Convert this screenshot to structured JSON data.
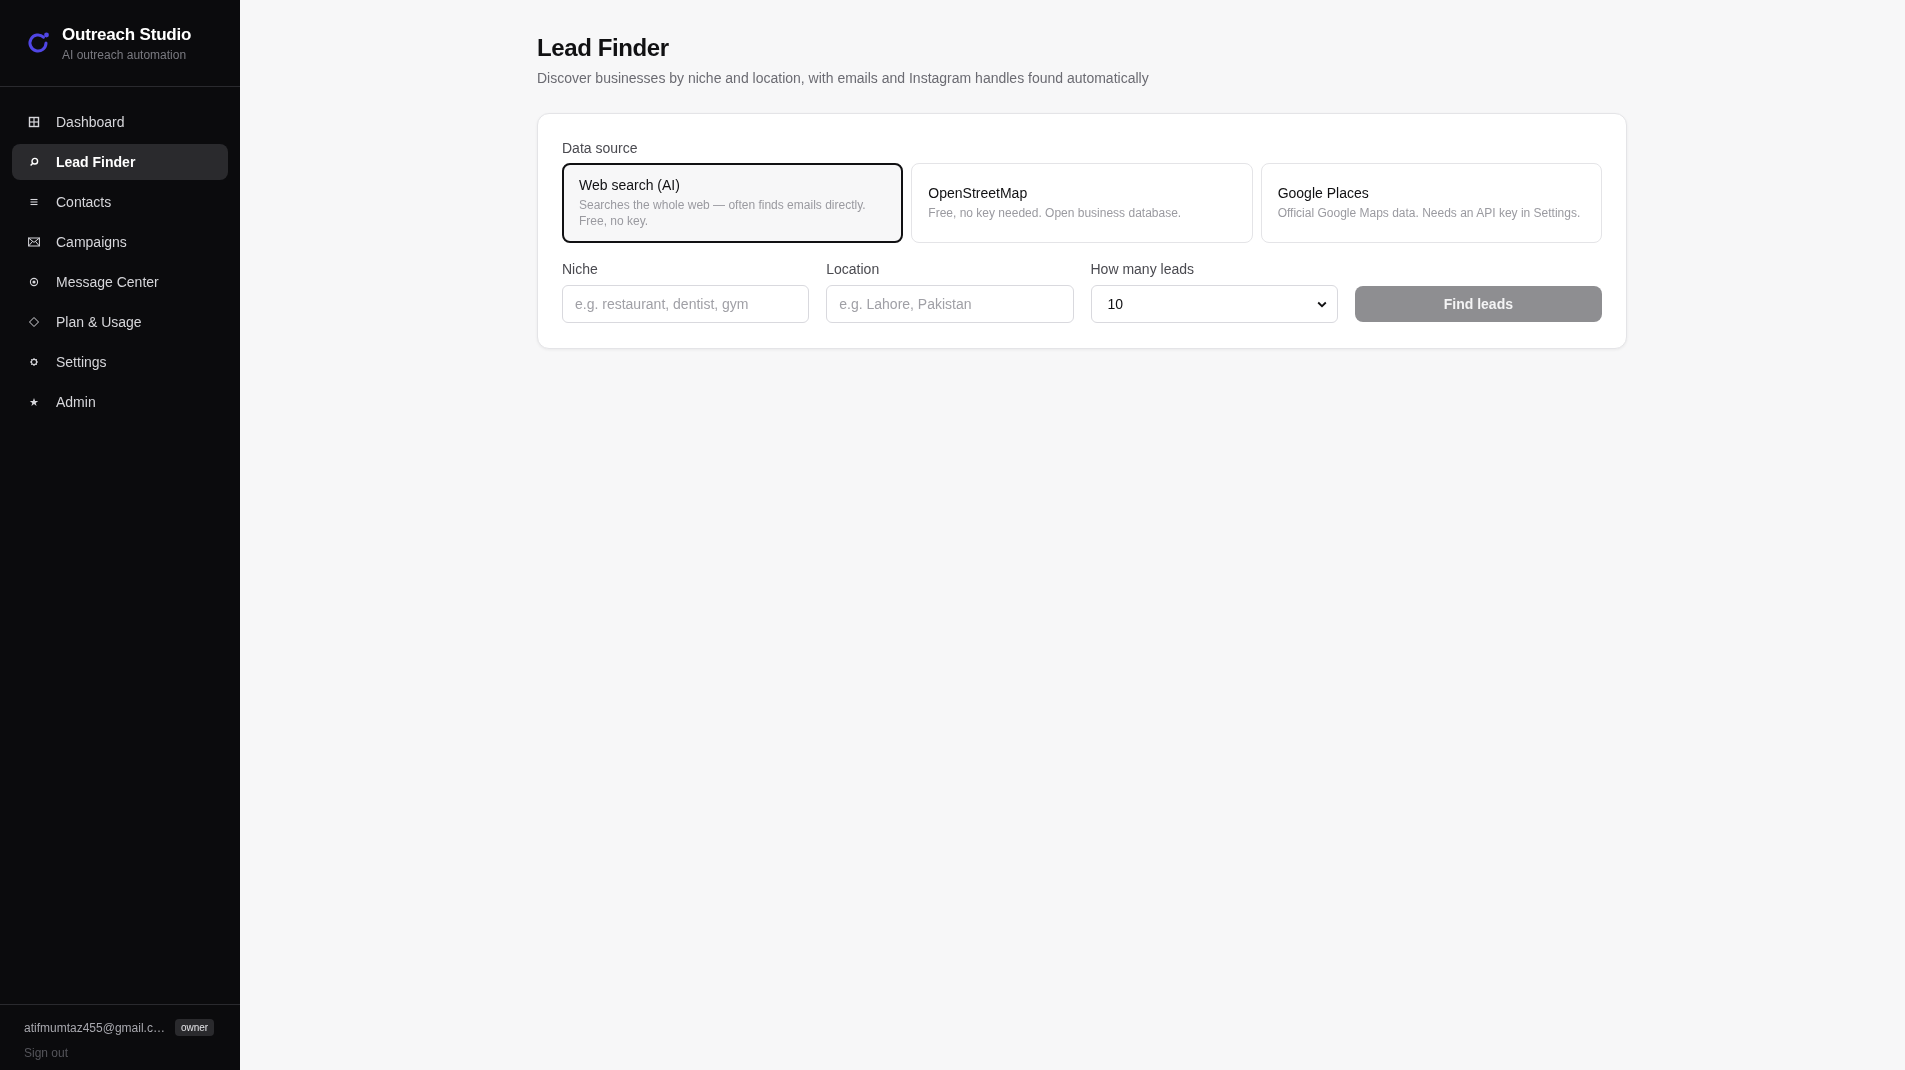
{
  "sidebar": {
    "brand": {
      "title": "Outreach Studio",
      "subtitle": "AI outreach automation"
    },
    "nav": [
      {
        "label": "Dashboard",
        "selected": false
      },
      {
        "label": "Lead Finder",
        "selected": true
      },
      {
        "label": "Contacts",
        "selected": false
      },
      {
        "label": "Campaigns",
        "selected": false
      },
      {
        "label": "Message Center",
        "selected": false
      },
      {
        "label": "Plan & Usage",
        "selected": false
      },
      {
        "label": "Settings",
        "selected": false
      },
      {
        "label": "Admin",
        "selected": false
      }
    ],
    "user": {
      "email": "atifmumtaz455@gmail.c…",
      "role": "owner",
      "sign_out": "Sign out"
    }
  },
  "page": {
    "title": "Lead Finder",
    "subtitle": "Discover businesses by niche and location, with emails and Instagram handles found automatically"
  },
  "form": {
    "source_label": "Data source",
    "sources": [
      {
        "title": "Web search (AI)",
        "description": "Searches the whole web — often finds emails directly. Free, no key.",
        "selected": true
      },
      {
        "title": "OpenStreetMap",
        "description": "Free, no key needed. Open business database.",
        "selected": false
      },
      {
        "title": "Google Places",
        "description": "Official Google Maps data. Needs an API key in Settings.",
        "selected": false
      }
    ],
    "fields": [
      {
        "kind": "input",
        "label": "Niche",
        "placeholder": "e.g. restaurant, dentist, gym"
      },
      {
        "kind": "input",
        "label": "Location",
        "placeholder": "e.g. Lahore, Pakistan"
      },
      {
        "kind": "select",
        "label": "How many leads",
        "value": "10"
      }
    ],
    "submit": {
      "label": "Find leads",
      "disabled": true
    }
  }
}
